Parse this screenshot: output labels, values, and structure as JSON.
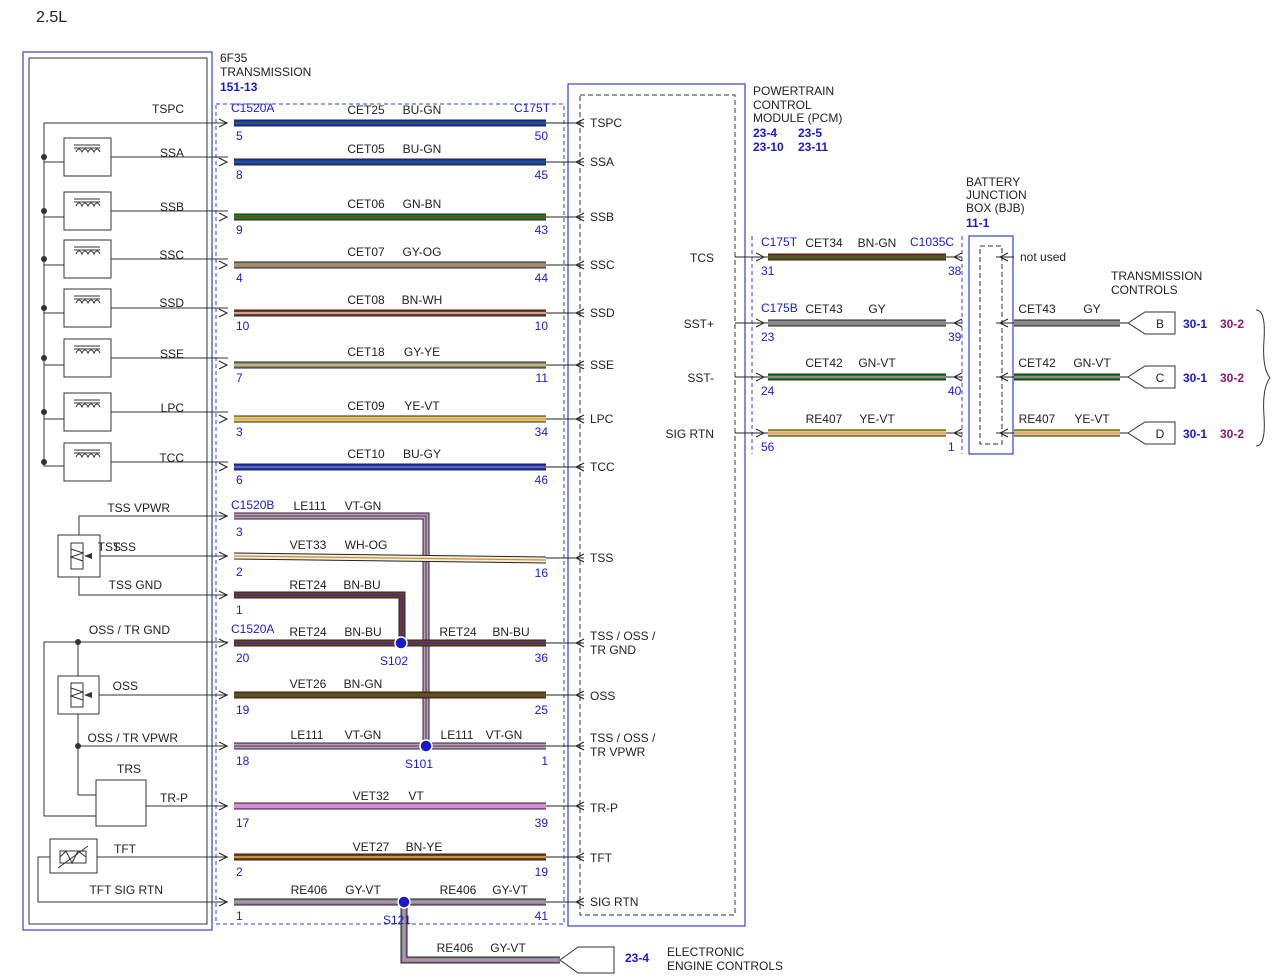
{
  "title": "2.5L",
  "transmission": {
    "name_line1": "6F35",
    "name_line2": "TRANSMISSION",
    "ref": "151-13"
  },
  "pcm": {
    "name_line1": "POWERTRAIN",
    "name_line2": "CONTROL",
    "name_line3": "MODULE (PCM)",
    "refs": [
      "23-4",
      "23-5",
      "23-10",
      "23-11"
    ]
  },
  "bjb": {
    "name_line1": "BATTERY",
    "name_line2": "JUNCTION",
    "name_line3": "BOX (BJB)",
    "ref": "11-1",
    "not_used": "not used"
  },
  "trans_controls": {
    "line1": "TRANSMISSION",
    "line2": "CONTROLS"
  },
  "eec": {
    "line1": "ELECTRONIC",
    "line2": "ENGINE CONTROLS",
    "ref": "23-4"
  },
  "connectors": {
    "c1520a": "C1520A",
    "c1520b": "C1520B",
    "c175t": "C175T",
    "c175b": "C175B",
    "c1035c": "C1035C"
  },
  "components": {
    "trs": "TRS",
    "tss": "TSS",
    "oss": "OSS",
    "tft": "TFT"
  },
  "left_labels": [
    "TSPC",
    "SSA",
    "SSB",
    "SSC",
    "SSD",
    "SSE",
    "LPC",
    "TCC",
    "TSS VPWR",
    "TSS",
    "TSS GND",
    "OSS / TR GND",
    "OSS",
    "OSS / TR VPWR",
    "TR-P",
    "TFT",
    "TFT SIG RTN"
  ],
  "pcm_pins": [
    "TSPC",
    "SSA",
    "SSB",
    "SSC",
    "SSD",
    "SSE",
    "LPC",
    "TCC",
    "TSS",
    "TSS / OSS /",
    "TR GND",
    "OSS",
    "TSS / OSS /",
    "TR VPWR",
    "TR-P",
    "TFT",
    "SIG RTN",
    "TCS",
    "SST+",
    "SST-",
    "SIG RTN"
  ],
  "wires": [
    {
      "circuit": "CET25",
      "color": "BU-GN",
      "pin_a": "5",
      "pin_b": "50"
    },
    {
      "circuit": "CET05",
      "color": "BU-GN",
      "pin_a": "8",
      "pin_b": "45"
    },
    {
      "circuit": "CET06",
      "color": "GN-BN",
      "pin_a": "9",
      "pin_b": "43"
    },
    {
      "circuit": "CET07",
      "color": "GY-OG",
      "pin_a": "4",
      "pin_b": "44"
    },
    {
      "circuit": "CET08",
      "color": "BN-WH",
      "pin_a": "10",
      "pin_b": "10"
    },
    {
      "circuit": "CET18",
      "color": "GY-YE",
      "pin_a": "7",
      "pin_b": "11"
    },
    {
      "circuit": "CET09",
      "color": "YE-VT",
      "pin_a": "3",
      "pin_b": "34"
    },
    {
      "circuit": "CET10",
      "color": "BU-GY",
      "pin_a": "6",
      "pin_b": "46"
    },
    {
      "circuit": "LE111",
      "color": "VT-GN",
      "pin_a": "3",
      "pin_b": ""
    },
    {
      "circuit": "VET33",
      "color": "WH-OG",
      "pin_a": "2",
      "pin_b": "16"
    },
    {
      "circuit": "RET24",
      "color": "BN-BU",
      "pin_a": "1",
      "pin_b": ""
    },
    {
      "circuit": "RET24",
      "color": "BN-BU",
      "pin_a": "20",
      "pin_b": "36",
      "right_circuit": "RET24",
      "right_color": "BN-BU"
    },
    {
      "circuit": "VET26",
      "color": "BN-GN",
      "pin_a": "19",
      "pin_b": "25"
    },
    {
      "circuit": "LE111",
      "color": "VT-GN",
      "pin_a": "18",
      "pin_b": "1",
      "right_circuit": "LE111",
      "right_color": "VT-GN"
    },
    {
      "circuit": "VET32",
      "color": "VT",
      "pin_a": "17",
      "pin_b": "39"
    },
    {
      "circuit": "VET27",
      "color": "BN-YE",
      "pin_a": "2",
      "pin_b": "19"
    },
    {
      "circuit": "RE406",
      "color": "GY-VT",
      "pin_a": "1",
      "pin_b": "41",
      "right_circuit": "RE406",
      "right_color": "GY-VT"
    },
    {
      "circuit": "RE406",
      "color": "GY-VT",
      "pin_a": "",
      "pin_b": ""
    }
  ],
  "splices": [
    "S102",
    "S101",
    "S121"
  ],
  "right_wires": [
    {
      "circuit": "CET34",
      "color": "BN-GN",
      "pin_a": "31",
      "pin_b": "38"
    },
    {
      "circuit": "CET43",
      "color": "GY",
      "pin_a": "23",
      "pin_b": "39",
      "out_circuit": "CET43",
      "out_color": "GY",
      "conn": "B"
    },
    {
      "circuit": "CET42",
      "color": "GN-VT",
      "pin_a": "24",
      "pin_b": "40",
      "out_circuit": "CET42",
      "out_color": "GN-VT",
      "conn": "C"
    },
    {
      "circuit": "RE407",
      "color": "YE-VT",
      "pin_a": "56",
      "pin_b": "1",
      "out_circuit": "RE407",
      "out_color": "YE-VT",
      "conn": "D"
    }
  ],
  "xrefs": {
    "blue": "30-1",
    "purple": "30-2"
  },
  "colors": {
    "blue_ref": "#1a1acc",
    "purple_ref": "#8a1a7a",
    "border_blue": "#3344cc"
  }
}
